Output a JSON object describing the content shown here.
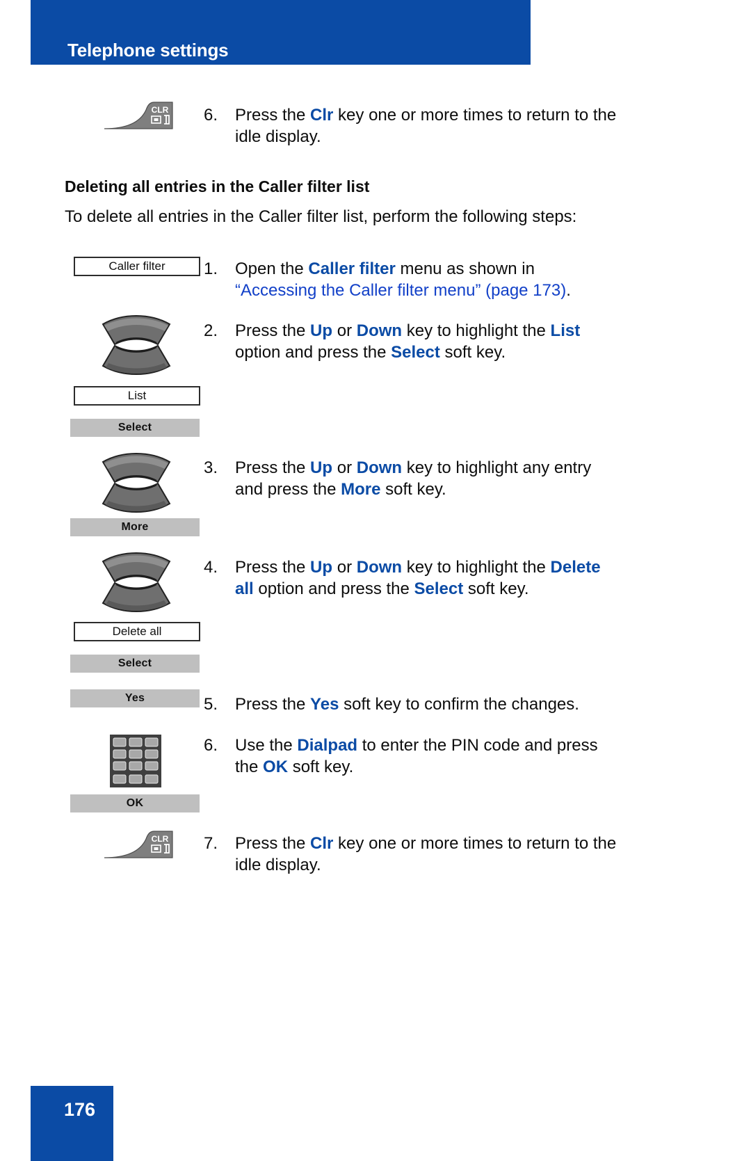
{
  "header": {
    "title": "Telephone settings",
    "band_color": "#0b4ba5"
  },
  "footer": {
    "page_number": "176",
    "band_color": "#0b4ba5"
  },
  "top_step": {
    "number": "6.",
    "icon": "clr-key-icon",
    "icon_label": "CLR",
    "text_parts": {
      "p1": "Press the ",
      "k1": "Clr",
      "p2": " key one or more times to return to the",
      "p3": "idle display."
    }
  },
  "section": {
    "heading": "Deleting all entries in the Caller filter list",
    "intro": "To delete all entries in the Caller filter list, perform the following steps:"
  },
  "steps": [
    {
      "number": "1.",
      "display_box": "Caller filter",
      "line1_p1": "Open the ",
      "line1_k1": "Caller filter",
      "line1_p2": " menu as shown in",
      "line2_link": "“Accessing the Caller filter menu” (page 173)",
      "line2_tail": "."
    },
    {
      "number": "2.",
      "nav_icon": "navigation-up-down-key-icon",
      "display_box": "List",
      "soft_key": "Select",
      "p1": "Press the ",
      "k1": "Up",
      "p2": " or ",
      "k2": "Down",
      "p3": " key to highlight the ",
      "k3": "List",
      "p4": "option and press the ",
      "k4": "Select",
      "p5": " soft key."
    },
    {
      "number": "3.",
      "nav_icon": "navigation-up-down-key-icon",
      "soft_key": "More",
      "p1": "Press the ",
      "k1": "Up",
      "p2": " or ",
      "k2": "Down",
      "p3": " key to highlight any entry",
      "p4": "and press the ",
      "k4": "More",
      "p5": " soft key."
    },
    {
      "number": "4.",
      "nav_icon": "navigation-up-down-key-icon",
      "display_box": "Delete all",
      "soft_key": "Select",
      "p1": "Press the ",
      "k1": "Up",
      "p2": " or ",
      "k2": "Down",
      "p3": " key to highlight the ",
      "k3": "Delete",
      "k3b": "all",
      "p4": " option and press the ",
      "k4": "Select",
      "p5": " soft key."
    },
    {
      "number": "5.",
      "soft_key": "Yes",
      "p1": "Press the ",
      "k1": "Yes",
      "p2": " soft key to confirm the changes."
    },
    {
      "number": "6.",
      "dialpad_icon": "dialpad-icon",
      "soft_key": "OK",
      "p1": "Use the ",
      "k1": "Dialpad",
      "p2": " to enter the PIN code and press",
      "p3": "the ",
      "k3": "OK",
      "p4": " soft key."
    },
    {
      "number": "7.",
      "icon": "clr-key-icon",
      "icon_label": "CLR",
      "p1": "Press the ",
      "k1": "Clr",
      "p2": " key one or more times to return to the",
      "p3": "idle display."
    }
  ],
  "colors": {
    "brand_blue": "#0b4ba5",
    "link_blue": "#1240c8",
    "soft_key_gray": "#bfbfbf",
    "key_gray": "#7f7f7f"
  }
}
